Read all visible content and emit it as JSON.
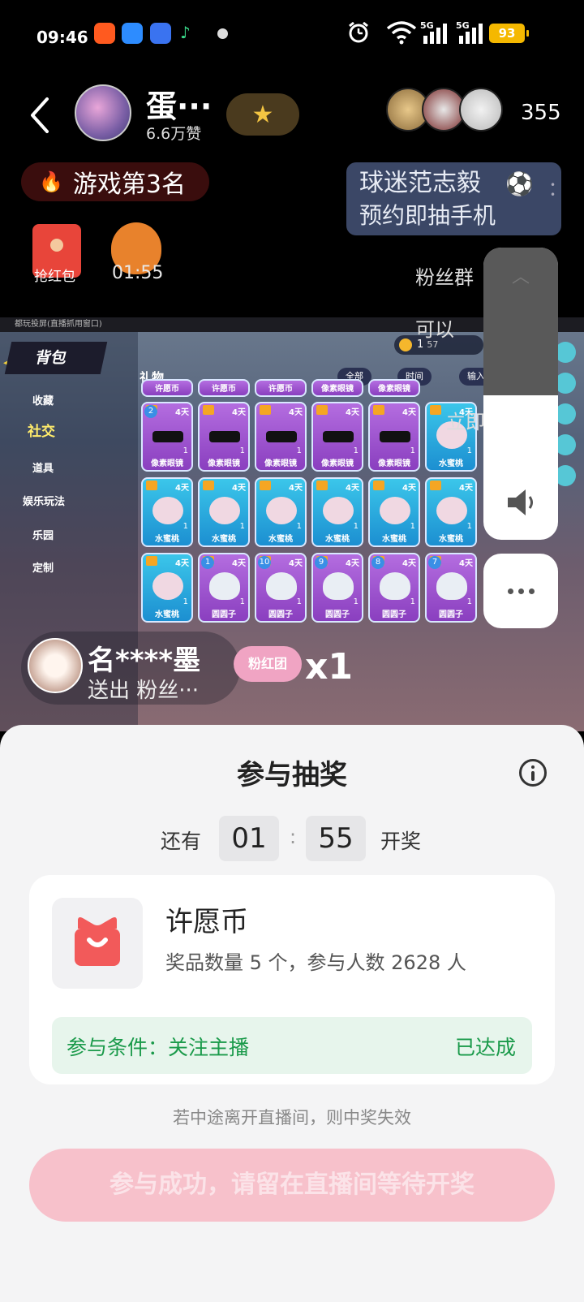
{
  "status_bar": {
    "time": "09:46",
    "network_1": "5G",
    "network_2": "5G",
    "battery": "93"
  },
  "header": {
    "streamer_name": "蛋···",
    "likes": "6.6万赞",
    "viewer_count": "355",
    "rank_label": "游戏第3名",
    "promo_line1": "球迷范志毅",
    "promo_line2": "预约即抽手机",
    "redpacket_label": "抢红包",
    "lucky_bag_timer": "01:55",
    "fans_group": "粉丝群",
    "side_hint_1": "可以",
    "side_hint_2": "立即"
  },
  "stream": {
    "window_title": "都玩投屏(直播抓用窗口)",
    "backpack_title": "背包",
    "menu": [
      "收藏",
      "社交",
      "道具",
      "娱乐玩法",
      "乐园",
      "定制"
    ],
    "gift_tab": "礼物",
    "filter_all": "全部",
    "filter_time": "时间",
    "search_placeholder": "输入",
    "coin_count": "1",
    "coin_sub": "57",
    "top_row_items": [
      "许愿币",
      "许愿币",
      "许愿币",
      "像素眼镜",
      "像素眼镜"
    ],
    "grid_rows": [
      [
        {
          "name": "像素眼镜",
          "days": "4天",
          "count": "1",
          "badge": "2"
        },
        {
          "name": "像素眼镜",
          "days": "4天",
          "count": "1"
        },
        {
          "name": "像素眼镜",
          "days": "4天",
          "count": "1"
        },
        {
          "name": "像素眼镜",
          "days": "4天",
          "count": "1"
        },
        {
          "name": "像素眼镜",
          "days": "4天",
          "count": "1"
        },
        {
          "name": "水蜜桃",
          "days": "4天",
          "count": "1"
        }
      ],
      [
        {
          "name": "水蜜桃",
          "days": "4天",
          "count": "1"
        },
        {
          "name": "水蜜桃",
          "days": "4天",
          "count": "1"
        },
        {
          "name": "水蜜桃",
          "days": "4天",
          "count": "1"
        },
        {
          "name": "水蜜桃",
          "days": "4天",
          "count": "1"
        },
        {
          "name": "水蜜桃",
          "days": "4天",
          "count": "1"
        },
        {
          "name": "水蜜桃",
          "days": "4天",
          "count": "1"
        }
      ],
      [
        {
          "name": "水蜜桃",
          "days": "4天",
          "count": "1"
        },
        {
          "name": "圆圆子",
          "days": "4天",
          "count": "1",
          "badge": "1"
        },
        {
          "name": "圆圆子",
          "days": "4天",
          "count": "1",
          "badge": "10"
        },
        {
          "name": "圆圆子",
          "days": "4天",
          "count": "1",
          "badge": "9"
        },
        {
          "name": "圆圆子",
          "days": "4天",
          "count": "1",
          "badge": "8"
        },
        {
          "name": "圆圆子",
          "days": "4天",
          "count": "1",
          "badge": "7"
        }
      ]
    ],
    "toast_user": "名****墨",
    "toast_action": "送出 粉丝···",
    "toast_gift": "粉红团",
    "toast_multiplier": "x1"
  },
  "lottery": {
    "title": "参与抽奖",
    "countdown_prefix": "还有",
    "minutes": "01",
    "seconds": "55",
    "countdown_suffix": "开奖",
    "prize_name": "许愿币",
    "prize_meta": "奖品数量 5 个，参与人数 2628 人",
    "condition": "参与条件：关注主播",
    "condition_state": "已达成",
    "warning": "若中途离开直播间，则中奖失效",
    "button_label": "参与成功，请留在直播间等待开奖"
  },
  "colors": {
    "accent_green": "#1a9a4a",
    "button_pink": "#f7c1cb",
    "prize_red": "#f25a5a"
  }
}
